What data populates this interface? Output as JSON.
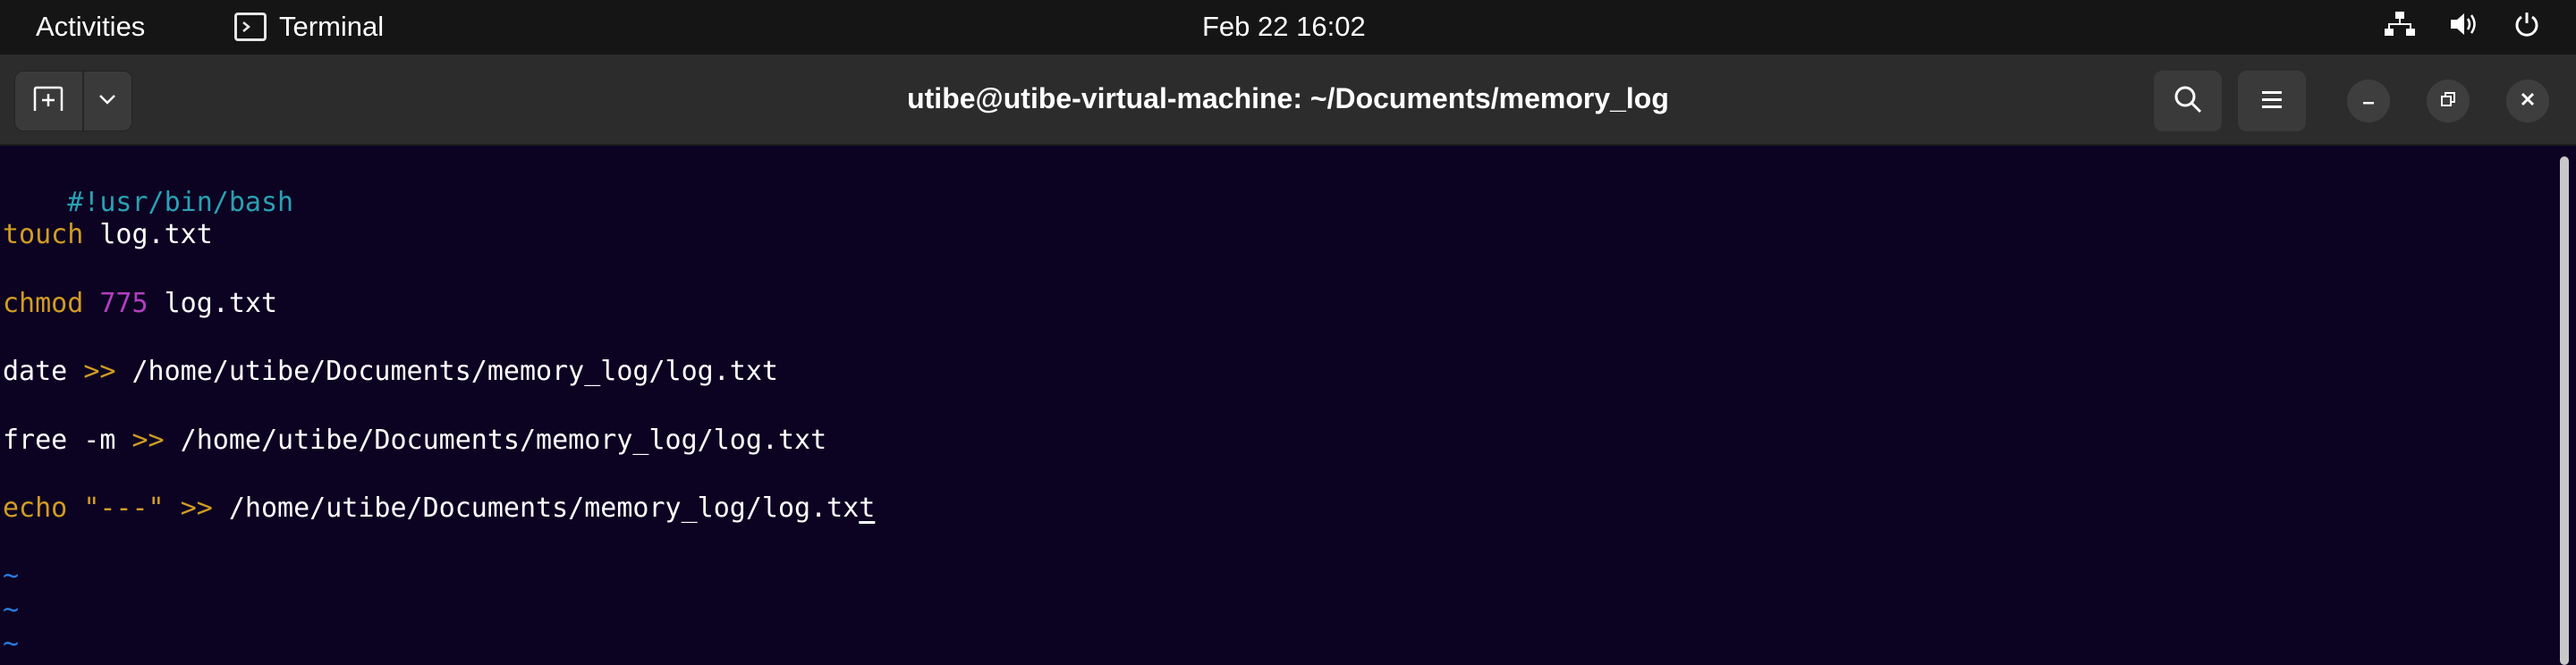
{
  "topbar": {
    "activities": "Activities",
    "app_name": "Terminal",
    "clock": "Feb 22  16:02",
    "icons": [
      "network-icon",
      "volume-icon",
      "power-icon"
    ]
  },
  "window": {
    "title": "utibe@utibe-virtual-machine: ~/Documents/memory_log",
    "buttons": [
      "new-tab-icon",
      "chevron-down-icon",
      "search-icon",
      "hamburger-menu-icon",
      "minimize-icon",
      "restore-icon",
      "close-icon"
    ]
  },
  "colors": {
    "background": "#0c0322",
    "shebang": "#2aa1b3",
    "keyword": "#d29c23",
    "number": "#b23ec0",
    "operator": "#d29c23",
    "string": "#d29c23",
    "tilde": "#2a7bde",
    "text": "#ffffff"
  },
  "editor": {
    "line1": {
      "shebang": "#!usr/bin/bash"
    },
    "line2": {
      "cmd": "touch",
      "rest": " log.txt"
    },
    "line3": {
      "cmd": "chmod",
      "sp": " ",
      "num": "775",
      "rest": " log.txt"
    },
    "line4": {
      "cmd": "date",
      "sp": " ",
      "op": ">>",
      "rest": " /home/utibe/Documents/memory_log/log.txt"
    },
    "line5": {
      "cmd": "free -m",
      "sp": " ",
      "op": ">>",
      "rest": " /home/utibe/Documents/memory_log/log.txt"
    },
    "line6": {
      "cmd": "echo",
      "sp": " ",
      "str": "\"---\"",
      "sp2": " ",
      "op": ">>",
      "rest": " /home/utibe/Documents/memory_log/log.tx",
      "cursor": "t"
    },
    "tilde": "~"
  }
}
